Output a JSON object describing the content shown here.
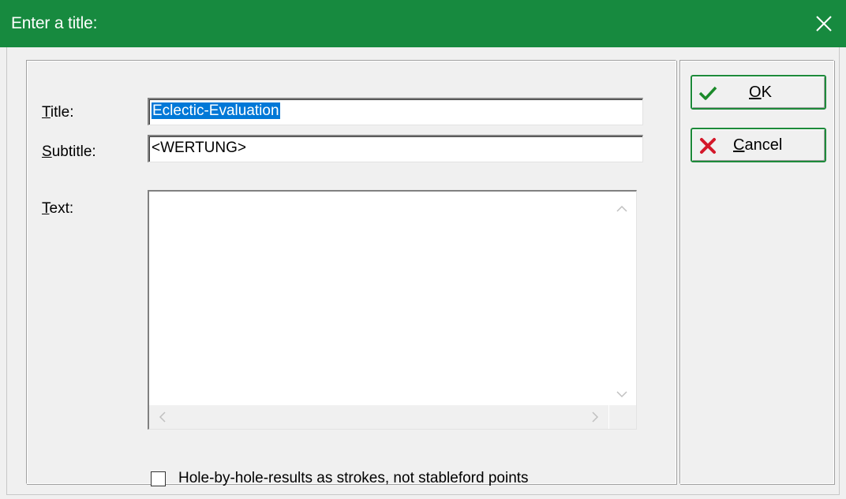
{
  "window": {
    "title": "Enter a title:",
    "close_icon": "close-icon",
    "titlebar_color": "#178a3f"
  },
  "form": {
    "title_label_mnemonic": "T",
    "title_label_rest": "itle:",
    "title_value": "Eclectic-Evaluation",
    "subtitle_label_mnemonic": "S",
    "subtitle_label_rest": "ubtitle:",
    "subtitle_value": "<WERTUNG>",
    "text_label_mnemonic": "T",
    "text_label_rest": "ext:",
    "text_value": "",
    "checkbox_label": "Hole-by-hole-results as strokes, not stableford points",
    "checkbox_checked": false
  },
  "buttons": {
    "ok_mnemonic": "O",
    "ok_rest": "K",
    "ok_icon": "checkmark-icon",
    "cancel_mnemonic": "C",
    "cancel_rest": "ancel",
    "cancel_icon": "red-x-icon",
    "border_color": "#1d8a3a"
  }
}
